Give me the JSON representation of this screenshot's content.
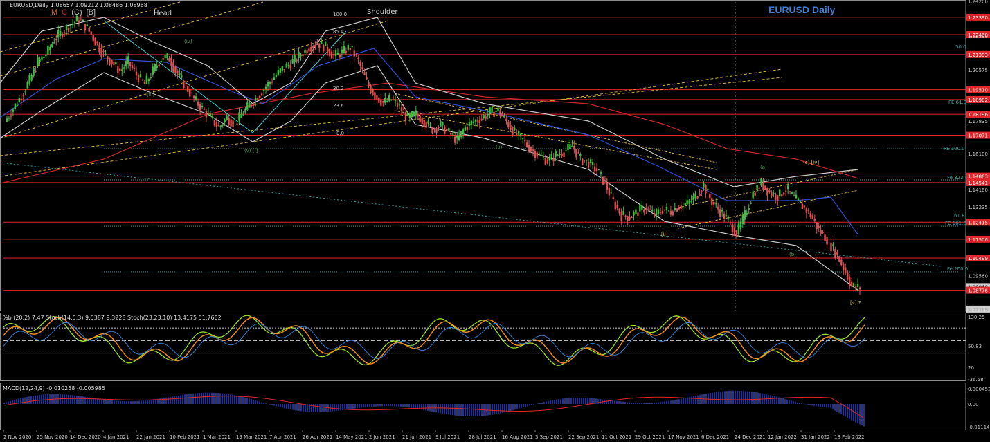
{
  "window": {
    "title": "EURUSD Daily",
    "header_ohlc": "EURUSD,Daily  1.08657 1.09212 1.08486 1.08968",
    "mode_buttons": [
      {
        "label": "M",
        "color": "#d66b2f"
      },
      {
        "label": "C",
        "color": "#b81c1c"
      },
      {
        "label": "(C)",
        "color": "#c0c0c0"
      },
      {
        "label": "[B]",
        "color": "#c0c0c0"
      }
    ]
  },
  "chart_data": {
    "type": "candlestick",
    "symbol": "EURUSD",
    "timeframe": "Daily",
    "ylim": [
      1.0765,
      1.242
    ],
    "price_ticks": [
      "1.24260",
      "1.22390",
      "1.20575",
      "1.19510",
      "1.17835",
      "1.16100",
      "1.14160",
      "1.13235",
      "1.11506",
      "1.09560",
      "1.07765"
    ],
    "price_labels": [
      {
        "value": "1.23390",
        "color": "#e0262a"
      },
      {
        "value": "1.22460",
        "color": "#e0262a"
      },
      {
        "value": "1.21393",
        "color": "#e0262a"
      },
      {
        "value": "1.19510",
        "color": "#e0262a"
      },
      {
        "value": "1.18982",
        "color": "#e0262a"
      },
      {
        "value": "1.18196",
        "color": "#e0262a"
      },
      {
        "value": "1.17071",
        "color": "#e0262a"
      },
      {
        "value": "1.14883",
        "color": "#e0262a"
      },
      {
        "value": "1.14541",
        "color": "#e0262a"
      },
      {
        "value": "1.12415",
        "color": "#e0262a"
      },
      {
        "value": "1.11506",
        "color": "#e0262a"
      },
      {
        "value": "1.10499",
        "color": "#e0262a"
      },
      {
        "value": "1.08968",
        "color": "#cfcfcf"
      },
      {
        "value": "1.08776",
        "color": "#e0262a"
      },
      {
        "value": "1.07765",
        "color": "#cfcfcf"
      }
    ],
    "x_labels": [
      "2 Nov 2020",
      "25 Nov 2020",
      "14 Dec 2020",
      "4 Jan 2021",
      "22 Jan 2021",
      "10 Feb 2021",
      "1 Mar 2021",
      "19 Mar 2021",
      "7 Apr 2021",
      "26 Apr 2021",
      "14 May 2021",
      "2 Jun 2021",
      "21 Jun 2021",
      "9 Jul 2021",
      "28 Jul 2021",
      "16 Aug 2021",
      "3 Sep 2021",
      "22 Sep 2021",
      "11 Oct 2021",
      "29 Oct 2021",
      "17 Nov 2021",
      "6 Dec 2021",
      "24 Dec 2021",
      "12 Jan 2022",
      "31 Jan 2022",
      "18 Feb 2022"
    ],
    "close_path": [
      1.178,
      1.185,
      1.192,
      1.2,
      1.21,
      1.214,
      1.222,
      1.226,
      1.23,
      1.233,
      1.228,
      1.221,
      1.214,
      1.21,
      1.205,
      1.21,
      1.203,
      1.198,
      1.205,
      1.212,
      1.212,
      1.203,
      1.197,
      1.19,
      1.185,
      1.18,
      1.175,
      1.18,
      1.177,
      1.183,
      1.188,
      1.193,
      1.198,
      1.203,
      1.207,
      1.21,
      1.214,
      1.218,
      1.22,
      1.218,
      1.213,
      1.215,
      1.218,
      1.21,
      1.199,
      1.192,
      1.188,
      1.19,
      1.186,
      1.18,
      1.182,
      1.178,
      1.174,
      1.176,
      1.172,
      1.168,
      1.175,
      1.178,
      1.18,
      1.183,
      1.184,
      1.178,
      1.172,
      1.168,
      1.163,
      1.16,
      1.157,
      1.16,
      1.162,
      1.165,
      1.158,
      1.156,
      1.152,
      1.145,
      1.135,
      1.128,
      1.127,
      1.13,
      1.132,
      1.128,
      1.131,
      1.13,
      1.133,
      1.134,
      1.138,
      1.144,
      1.135,
      1.13,
      1.125,
      1.118,
      1.128,
      1.14,
      1.145,
      1.14,
      1.138,
      1.142,
      1.137,
      1.133,
      1.128,
      1.12,
      1.115,
      1.108,
      1.1,
      1.09,
      1.089
    ],
    "annotations": [
      {
        "text": "Head",
        "color": "#c8c8c8"
      },
      {
        "text": "Shoulder",
        "color": "#c8c8c8"
      },
      {
        "text": "100.0",
        "color": "#c8c8c8"
      },
      {
        "text": "85.4",
        "color": "#c8c8c8"
      },
      {
        "text": "30.2",
        "color": "#c8c8c8"
      },
      {
        "text": "23.6",
        "color": "#c8c8c8"
      },
      {
        "text": "0.0",
        "color": "#c8c8c8"
      },
      {
        "text": "50.0",
        "color": "#3fa6a6"
      },
      {
        "text": "FE 61.8",
        "color": "#3fa6a6"
      },
      {
        "text": "FE 100.0",
        "color": "#3fa6a6"
      },
      {
        "text": "Fe 323.6",
        "color": "#3fa6a6"
      },
      {
        "text": "61.8",
        "color": "#3fa6a6"
      },
      {
        "text": "FE 161.8",
        "color": "#3fa6a6"
      },
      {
        "text": "Fe 200.0",
        "color": "#3fa6a6"
      },
      {
        "text": "(a)",
        "color": "#3fa64a"
      },
      {
        "text": "(b)",
        "color": "#3fa64a"
      },
      {
        "text": "(c) [iv]",
        "color": "#d8c23a"
      },
      {
        "text": "[v] ?",
        "color": "#d8c23a"
      },
      {
        "text": "(iii)",
        "color": "#3fa64a"
      },
      {
        "text": "(v) [i]",
        "color": "#3fa64a"
      },
      {
        "text": "(ii)",
        "color": "#3fa64a"
      },
      {
        "text": "[ii]",
        "color": "#d8c23a"
      },
      {
        "text": "(iv)",
        "color": "#3fa64a"
      }
    ],
    "stoch_header": "%b (20,2) 7.47  Stoch(14,5,3) 9.5387 9.3228  Stoch(23,23,10) 13.4175 51.7602",
    "stoch_ticks": [
      "130.25",
      "50.83",
      "20",
      "-36.58"
    ],
    "macd_header": "MACD(12,24,9) -0.010258 -0.005985",
    "macd_ticks": [
      "0.000452",
      "0.00",
      "-0.011149"
    ]
  },
  "colors": {
    "bull": "#3fbf3f",
    "bear": "#e05050",
    "hline": "#e0262a",
    "fib": "#2fa6a6",
    "channel": "#d8b43a",
    "ma_blue": "#2f4fd6",
    "ma_red": "#c8282a",
    "band": "#c8c8c8",
    "stoch_green": "#9be02a",
    "stoch_orange": "#f08a1c"
  }
}
